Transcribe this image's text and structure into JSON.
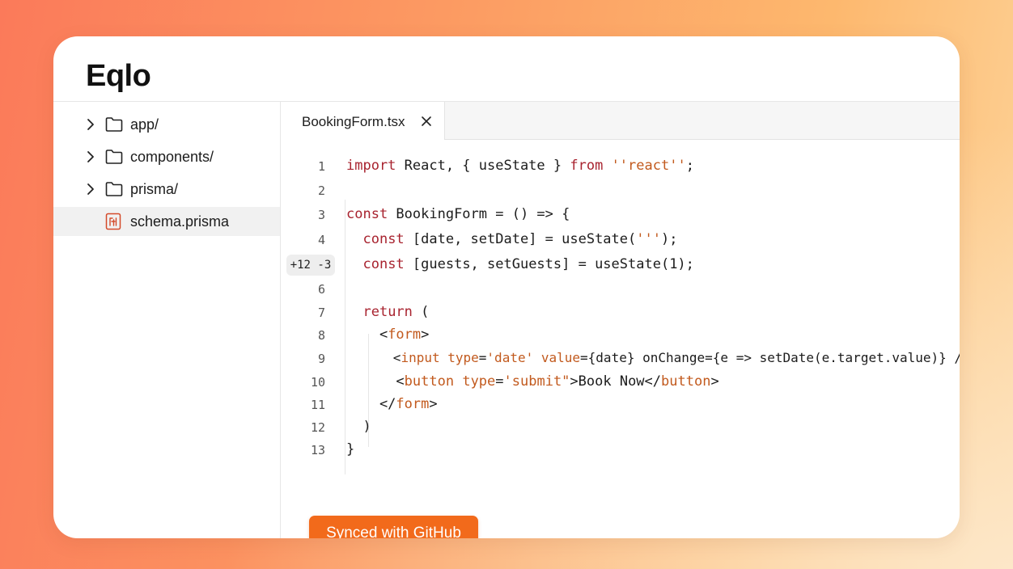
{
  "app": {
    "title": "Eqlo"
  },
  "sidebar": {
    "items": [
      {
        "label": "app/",
        "type": "folder"
      },
      {
        "label": "components/",
        "type": "folder"
      },
      {
        "label": "prisma/",
        "type": "folder"
      },
      {
        "label": "schema.prisma",
        "type": "file",
        "selected": true
      }
    ]
  },
  "editor": {
    "tab": {
      "label": "BookingForm.tsx"
    },
    "diff_badge": "+12 -3",
    "line_numbers": [
      "1",
      "2",
      "3",
      "4",
      "",
      "6",
      "7",
      "8",
      "9",
      "10",
      "11",
      "12",
      "13"
    ]
  },
  "sync_button": {
    "label": "Synced with GitHub"
  },
  "colors": {
    "accent": "#f26a1b",
    "keyword": "#a8232f",
    "string": "#c25a1e"
  },
  "icons": [
    "chevron-right-icon",
    "folder-icon",
    "prisma-file-icon",
    "close-icon"
  ]
}
